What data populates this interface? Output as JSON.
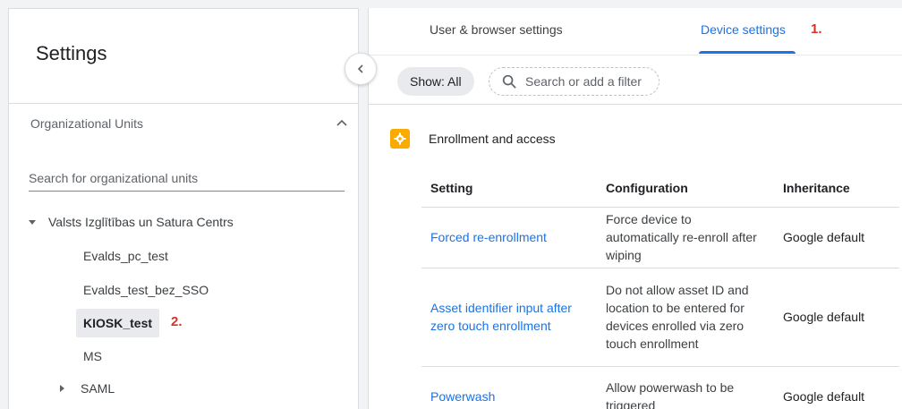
{
  "left_panel": {
    "title": "Settings",
    "org_units_label": "Organizational Units",
    "search_placeholder": "Search for organizational units",
    "root": "Valsts Izglītības un Satura Centrs",
    "children": [
      "Evalds_pc_test",
      "Evalds_test_bez_SSO",
      "KIOSK_test",
      "MS"
    ],
    "collapsed_child": "SAML",
    "selected_marker": "2."
  },
  "tabs": {
    "user_browser": "User & browser settings",
    "device": "Device settings",
    "device_marker": "1."
  },
  "filter": {
    "show_chip": "Show: All",
    "search_placeholder": "Search or add a filter"
  },
  "section": {
    "title": "Enrollment and access"
  },
  "table": {
    "headers": [
      "Setting",
      "Configuration",
      "Inheritance"
    ],
    "rows": [
      {
        "setting": "Forced re-enrollment",
        "configuration": "Force device to automatically re-enroll after wiping",
        "inheritance": "Google default"
      },
      {
        "setting": "Asset identifier input after zero touch enrollment",
        "configuration": "Do not allow asset ID and location to be entered for devices enrolled via zero touch enrollment",
        "inheritance": "Google default"
      },
      {
        "setting": "Powerwash",
        "configuration": "Allow powerwash to be triggered",
        "inheritance": "Google default"
      }
    ]
  },
  "colors": {
    "accent": "#1a73e8",
    "marker_red": "#d93025",
    "section_icon": "#f9ab00"
  }
}
